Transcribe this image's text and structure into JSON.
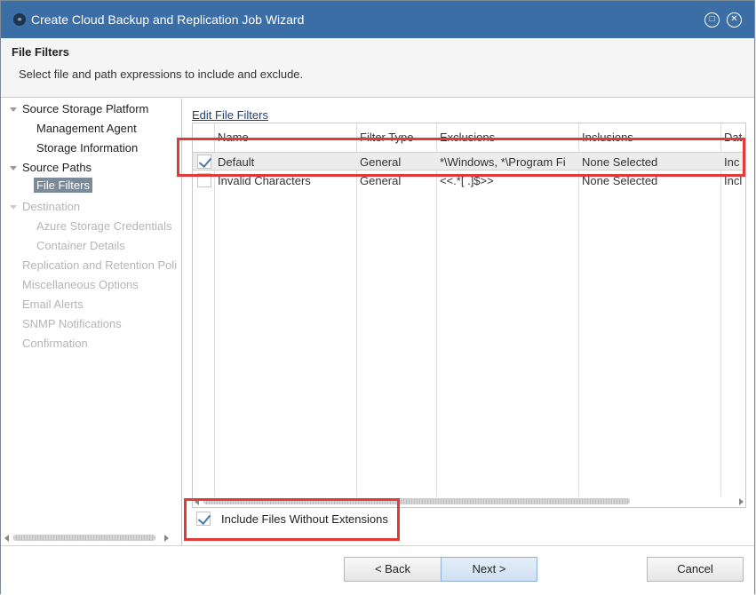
{
  "window": {
    "title": "Create Cloud Backup and Replication Job Wizard",
    "maximize_glyph": "□",
    "close_glyph": "✕",
    "logo_glyph": "⚭"
  },
  "header": {
    "title": "File Filters",
    "description": "Select file and path expressions to include and exclude."
  },
  "nav": {
    "items": [
      {
        "label": "Source Storage Platform",
        "state": "normal"
      },
      {
        "label": "Management Agent",
        "state": "normal"
      },
      {
        "label": "Storage Information",
        "state": "normal"
      },
      {
        "label": "Source Paths",
        "state": "normal"
      },
      {
        "label": "File Filters",
        "state": "selected"
      },
      {
        "label": "Destination",
        "state": "dim"
      },
      {
        "label": "Azure Storage Credentials",
        "state": "dim"
      },
      {
        "label": "Container Details",
        "state": "dim"
      },
      {
        "label": "Replication and Retention Poli",
        "state": "dim"
      },
      {
        "label": "Miscellaneous Options",
        "state": "dim"
      },
      {
        "label": "Email Alerts",
        "state": "dim"
      },
      {
        "label": "SNMP Notifications",
        "state": "dim"
      },
      {
        "label": "Confirmation",
        "state": "dim"
      }
    ]
  },
  "filters": {
    "edit_link": "Edit File Filters",
    "columns": [
      "Name",
      "Filter Type",
      "Exclusions",
      "Inclusions",
      "Dat"
    ],
    "rows": [
      {
        "checked": true,
        "name": "Default",
        "type": "General",
        "exclusions": "*\\Windows, *\\Program Fi",
        "inclusions": "None Selected",
        "date": "Inc"
      },
      {
        "checked": false,
        "name": "Invalid Characters",
        "type": "General",
        "exclusions": "<<.*[ .]$>>",
        "inclusions": "None Selected",
        "date": "Incl"
      }
    ]
  },
  "options": {
    "include_no_ext_label": "Include Files Without Extensions",
    "include_no_ext_checked": true
  },
  "buttons": {
    "back": "< Back",
    "next": "Next >",
    "cancel": "Cancel"
  },
  "colors": {
    "title_bar": "#3a6ea5",
    "highlight_box": "#e03a3a",
    "nav_selected": "#7a8a98"
  }
}
